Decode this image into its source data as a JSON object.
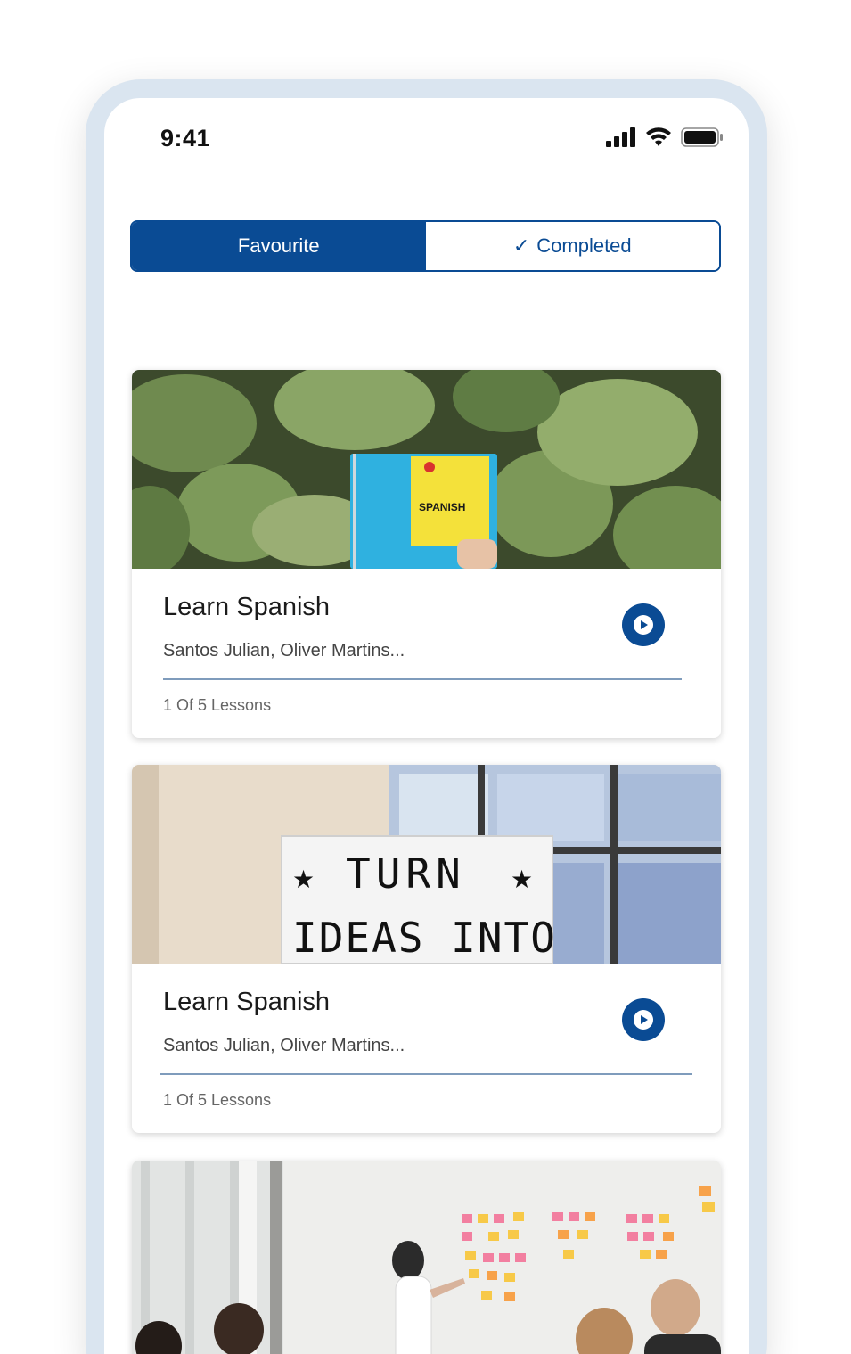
{
  "status_bar": {
    "time": "9:41",
    "icons": [
      "cellular-signal-icon",
      "wifi-icon",
      "battery-icon"
    ]
  },
  "tabs": [
    {
      "label": "Favourite",
      "active": true
    },
    {
      "label": "Completed",
      "active": false,
      "icon": "check-icon"
    }
  ],
  "cards": [
    {
      "title": "Learn Spanish",
      "authors": "Santos Julian, Oliver Martins...",
      "lessons": "1 Of 5 Lessons",
      "image_text": "SPANISH"
    },
    {
      "title": "Learn Spanish",
      "authors": "Santos Julian, Oliver Martins...",
      "lessons": "1 Of 5 Lessons",
      "image_text_line1": "TURN",
      "image_text_line2": "IDEAS INTO"
    }
  ],
  "colors": {
    "primary": "#0a4b94",
    "frame": "#dae5f0"
  }
}
